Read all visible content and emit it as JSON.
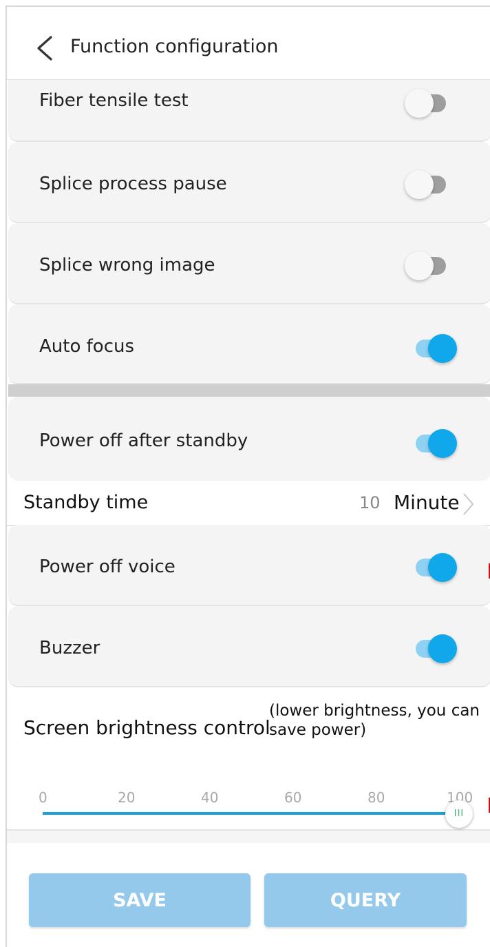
{
  "header": {
    "title": "Function configuration"
  },
  "rows": [
    {
      "label": "Fiber tensile test",
      "on": false
    },
    {
      "label": "Splice process pause",
      "on": false
    },
    {
      "label": "Splice wrong image",
      "on": false
    },
    {
      "label": "Auto focus",
      "on": true
    },
    {
      "label": "Power off after standby",
      "on": true
    },
    {
      "label": "Power off voice",
      "on": true
    },
    {
      "label": "Buzzer",
      "on": true
    }
  ],
  "standby": {
    "label": "Standby time",
    "value": "10",
    "unit": "Minute"
  },
  "brightness": {
    "label": "Screen brightness control",
    "note": "(lower brightness, you can save power)",
    "ticks": [
      "0",
      "20",
      "40",
      "60",
      "80",
      "100"
    ],
    "value": 100,
    "knob_glyph": "III"
  },
  "buttons": {
    "save": "SAVE",
    "query": "QUERY"
  },
  "colors": {
    "accent": "#10a8ea",
    "button": "#94c9ec",
    "toggle_off": "#9e9e9e"
  }
}
